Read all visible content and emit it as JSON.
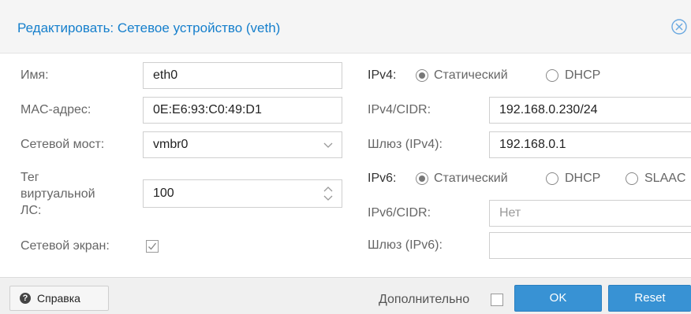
{
  "dialog": {
    "title": "Редактировать: Сетевое устройство (veth)",
    "close_icon": "close-circle-icon"
  },
  "left": {
    "name_label": "Имя:",
    "name_value": "eth0",
    "mac_label": "MAC-адрес:",
    "mac_value": "0E:E6:93:C0:49:D1",
    "bridge_label": "Сетевой мост:",
    "bridge_value": "vmbr0",
    "vlan_label_1": "Тег",
    "vlan_label_2": "виртуальной",
    "vlan_label_3": "ЛС:",
    "vlan_value": "100",
    "firewall_label": "Сетевой экран:",
    "firewall_checked": true
  },
  "right": {
    "ipv4_label": "IPv4:",
    "ipv4_mode_static": "Статический",
    "ipv4_mode_dhcp": "DHCP",
    "ipv4_selected": "Статический",
    "ipv4_cidr_label": "IPv4/CIDR:",
    "ipv4_cidr_value": "192.168.0.230/24",
    "gw4_label": "Шлюз (IPv4):",
    "gw4_value": "192.168.0.1",
    "ipv6_label": "IPv6:",
    "ipv6_mode_static": "Статический",
    "ipv6_mode_dhcp": "DHCP",
    "ipv6_mode_slaac": "SLAAC",
    "ipv6_selected": "Статический",
    "ipv6_cidr_label": "IPv6/CIDR:",
    "ipv6_cidr_placeholder": "Нет",
    "gw6_label": "Шлюз (IPv6):",
    "gw6_value": ""
  },
  "footer": {
    "help_label": "Справка",
    "advanced_label": "Дополнительно",
    "advanced_checked": false,
    "ok_label": "OK",
    "reset_label": "Reset"
  },
  "colors": {
    "title": "#157fcc",
    "primary_button": "#3892d4"
  }
}
